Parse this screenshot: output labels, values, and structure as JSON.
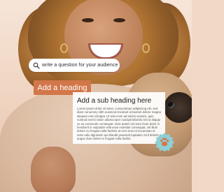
{
  "search": {
    "text": "write a question for your audience",
    "icon": "search-icon"
  },
  "heading_button": {
    "label": "Add a heading",
    "color": "#d2774a"
  },
  "card": {
    "title": "Add a sub heading here",
    "body": "Lorem ipsum dolor sit amet, consectetuer adipiscing elit, sed diam nonummy nibh euismod tincidunt ut laoreet dolore magna aliquam erat volutpat. Ut wisi enim ad minim veniam, quis nostrud exerci tation ullamcorper suscipit lobortis nisl ut aliquip ex ea commodo consequat. Duis autem vel eum iriure dolor in hendrerit in vulputate velit esse molestie consequat, vel illum dolore eu feugiat nulla facilisis at vero eros et accumsan et iusto odio dignissim qui blandit praesent luptatum zzril delenit augue duis dolore te feugait nulla facilisi."
  },
  "badge": {
    "icon": "paw-icon",
    "color": "#8fcfd6"
  }
}
